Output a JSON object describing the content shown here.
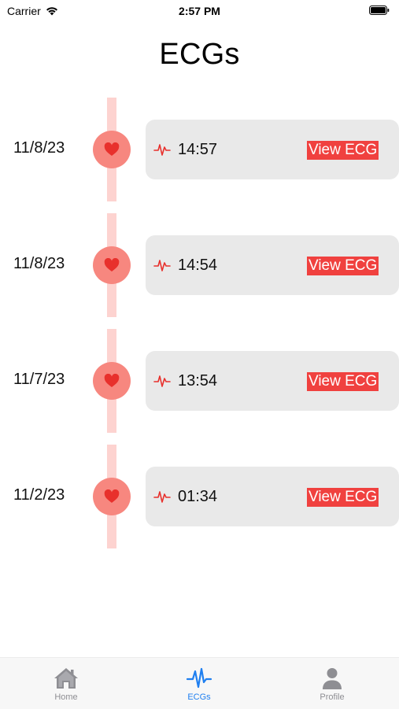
{
  "status_bar": {
    "carrier": "Carrier",
    "time": "2:57 PM"
  },
  "page": {
    "title": "ECGs"
  },
  "ecgs": [
    {
      "date": "11/8/23",
      "time": "14:57",
      "action_label": "View ECG"
    },
    {
      "date": "11/8/23",
      "time": "14:54",
      "action_label": "View ECG"
    },
    {
      "date": "11/7/23",
      "time": "13:54",
      "action_label": "View ECG"
    },
    {
      "date": "11/2/23",
      "time": "01:34",
      "action_label": "View ECG"
    }
  ],
  "tab_bar": {
    "tabs": [
      {
        "label": "Home",
        "icon": "house-icon",
        "selected": false
      },
      {
        "label": "ECGs",
        "icon": "waveform-icon",
        "selected": true
      },
      {
        "label": "Profile",
        "icon": "person-icon",
        "selected": false
      }
    ]
  },
  "colors": {
    "accent_red": "#f0413f",
    "heart_circle": "#f7877f",
    "timeline": "#fdd3d0",
    "card_background": "#e9e9e9",
    "tab_selected": "#1f7ff0",
    "tab_unselected": "#8e8e93"
  }
}
